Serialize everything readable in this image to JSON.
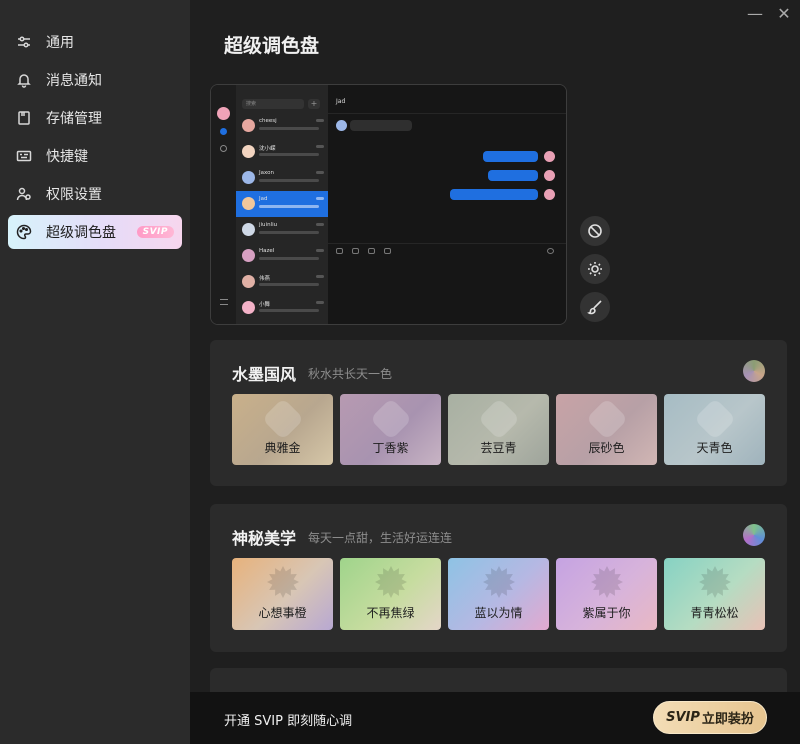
{
  "sidebar": {
    "items": [
      {
        "label": "通用",
        "icon": "sliders-icon"
      },
      {
        "label": "消息通知",
        "icon": "bell-icon"
      },
      {
        "label": "存储管理",
        "icon": "folder-icon"
      },
      {
        "label": "快捷键",
        "icon": "keyboard-icon"
      },
      {
        "label": "权限设置",
        "icon": "user-shield-icon"
      },
      {
        "label": "超级调色盘",
        "icon": "palette-icon",
        "badge": "SVIP",
        "active": true
      }
    ]
  },
  "window": {
    "minimize": "—",
    "close": "✕"
  },
  "page": {
    "title": "超级调色盘"
  },
  "preview": {
    "search_placeholder": "搜索",
    "plus": "+",
    "chat_title": "Jad",
    "contacts": [
      {
        "name": "cheesj",
        "color": "#e7a8a0"
      },
      {
        "name": "沈小嵘",
        "color": "#f2d4c0"
      },
      {
        "name": "Jaxon",
        "color": "#9cb7e8"
      },
      {
        "name": "Jad",
        "color": "#f1c79b",
        "selected": true
      },
      {
        "name": "jiuinliu",
        "color": "#cfd8e6"
      },
      {
        "name": "Hazel",
        "color": "#d7a0c2"
      },
      {
        "name": "伟燕",
        "color": "#e0b0a5"
      },
      {
        "name": "小舞",
        "color": "#f4b2c8"
      }
    ]
  },
  "tools": [
    {
      "name": "disable-icon"
    },
    {
      "name": "brightness-icon"
    },
    {
      "name": "brush-icon"
    }
  ],
  "sections": [
    {
      "title": "水墨国风",
      "subtitle": "秋水共长天一色",
      "dot_colors": [
        "#8b9d74",
        "#c9a58a",
        "#a691b5"
      ],
      "cards": [
        {
          "label": "典雅金",
          "colors": [
            "#c9b08a",
            "#b8a78f",
            "#d6c7a8"
          ]
        },
        {
          "label": "丁香紫",
          "colors": [
            "#b79ab1",
            "#a893b0",
            "#c8b4c4"
          ]
        },
        {
          "label": "芸豆青",
          "colors": [
            "#a8b0a2",
            "#b6b9ac",
            "#9ea49b"
          ]
        },
        {
          "label": "辰砂色",
          "colors": [
            "#c8a3a6",
            "#b7a0a6",
            "#d1b6b4"
          ]
        },
        {
          "label": "天青色",
          "colors": [
            "#a6bcc4",
            "#b8c6ca",
            "#9fb3bc"
          ]
        }
      ]
    },
    {
      "title": "神秘美学",
      "subtitle": "每天一点甜，生活好运连连",
      "dot_colors": [
        "#7fc28a",
        "#5f8fd8",
        "#b46fc8"
      ],
      "cards": [
        {
          "label": "心想事橙",
          "colors": [
            "#e7b27c",
            "#d8c6b5",
            "#b8a8d2"
          ]
        },
        {
          "label": "不再焦绿",
          "colors": [
            "#9fd48b",
            "#c6dc9f",
            "#e4d6c8"
          ]
        },
        {
          "label": "蓝以为情",
          "colors": [
            "#8ec3e4",
            "#b5b8e3",
            "#e2a9cf"
          ]
        },
        {
          "label": "紫属于你",
          "colors": [
            "#c5a3e2",
            "#d7b3db",
            "#e8b8c4"
          ]
        },
        {
          "label": "青青松松",
          "colors": [
            "#86d2c3",
            "#b5dcc2",
            "#e8c1b6"
          ]
        }
      ]
    }
  ],
  "bottom": {
    "text": "开通 SVIP 即刻随心调",
    "button_sv": "SVIP",
    "button_label": "立即装扮"
  }
}
